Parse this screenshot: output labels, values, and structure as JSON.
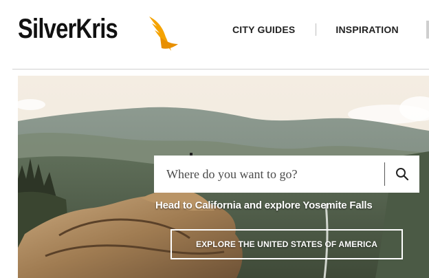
{
  "brand": {
    "logo_text": "SilverKris",
    "logo_accent_color": "#f5a300",
    "logo_icon": "singapore-girl-bird-icon"
  },
  "nav": {
    "items": [
      {
        "label": "CITY GUIDES"
      },
      {
        "label": "INSPIRATION"
      }
    ]
  },
  "hero": {
    "image": "mountain-valley-landscape",
    "search": {
      "placeholder": "Where do you want to go?",
      "icon": "search-icon"
    },
    "tagline": "Head to California and explore Yosemite Falls",
    "cta_label": "EXPLORE THE UNITED STATES OF AMERICA"
  }
}
